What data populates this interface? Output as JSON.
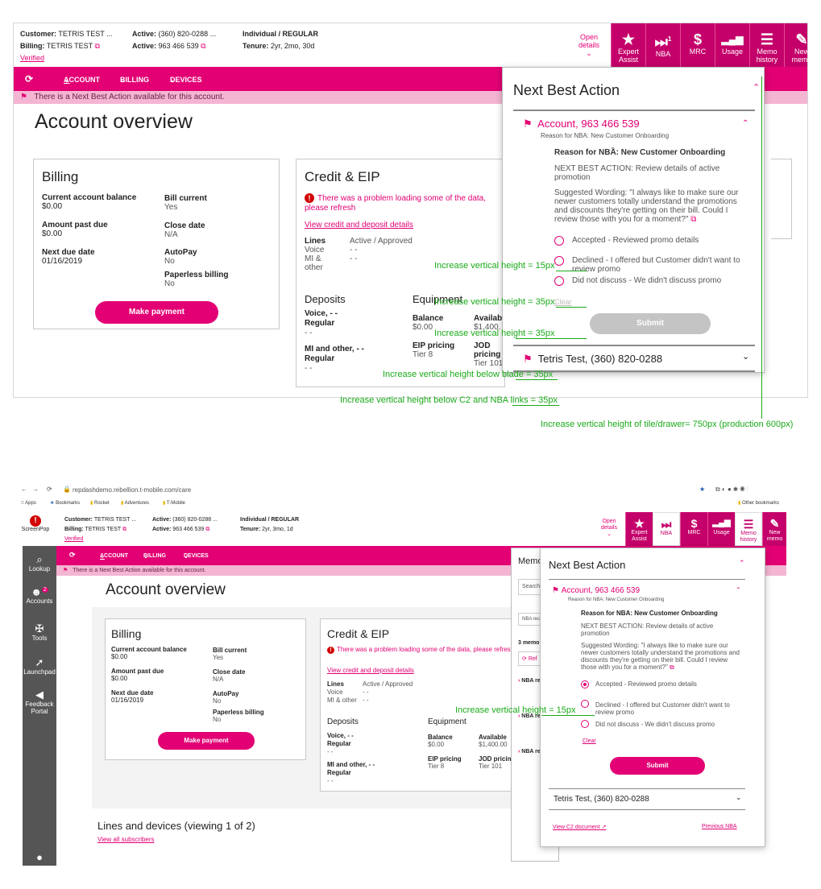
{
  "top": {
    "customer_label": "Customer:",
    "customer_value": "TETRIS TEST",
    "billing_label": "Billing:",
    "billing_value": "TETRIS TEST",
    "verified": "Verified",
    "active_label": "Active:",
    "active_phone": "(360) 820-0288",
    "active_account": "963 466 539",
    "type": "Individual  /  REGULAR",
    "tenure_label": "Tenure:",
    "tenure_value": "2yr, 2mo, 30d",
    "open_details": "Open details",
    "buttons": [
      {
        "label": "Expert Assist",
        "icon": "star-icon",
        "glyph": "★"
      },
      {
        "label": "NBA",
        "icon": "nba-icon",
        "glyph": "⏭",
        "badge": "1"
      },
      {
        "label": "MRC",
        "icon": "dollar-icon",
        "glyph": "$"
      },
      {
        "label": "Usage",
        "icon": "signal-bars-icon",
        "glyph": "▂▄▆"
      },
      {
        "label": "Memo history",
        "icon": "list-icon",
        "glyph": "☰"
      },
      {
        "label": "New memo",
        "icon": "edit-icon",
        "glyph": "✎"
      }
    ],
    "nav": {
      "account": "ACCOUNT",
      "billing": "BILLING",
      "devices": "DEVICES"
    },
    "nba_banner": "There is a Next Best Action available for this account.",
    "page_title": "Account overview",
    "billing": {
      "title": "Billing",
      "current_balance_label": "Current account balance",
      "current_balance": "$0.00",
      "past_due_label": "Amount past due",
      "past_due": "$0.00",
      "next_due_label": "Next due date",
      "next_due": "01/16/2019",
      "bill_current_label": "Bill current",
      "bill_current": "Yes",
      "close_date_label": "Close date",
      "close_date": "N/A",
      "autopay_label": "AutoPay",
      "autopay": "No",
      "paperless_label": "Paperless billing",
      "paperless": "No",
      "pay_button": "Make payment"
    },
    "credit": {
      "title": "Credit & EIP",
      "error": "There was a problem loading some of the data, please refresh",
      "link": "View credit and deposit details",
      "lines_label": "Lines",
      "status": "Active / Approved",
      "voice": "Voice",
      "voice_val": "- -",
      "mi": "MI & other",
      "mi_val": "- -",
      "deposits": "Deposits",
      "dep_voice": "Voice, - -",
      "dep_regular": "Regular",
      "dep_dash": "- -",
      "dep_mi": "MI and other, - -",
      "dep_regular2": "Regular",
      "dep_dash2": "- -",
      "equipment": "Equipment",
      "balance_label": "Balance",
      "balance": "$0.00",
      "available_label": "Available",
      "available": "$1,400.",
      "eip_label": "EIP pricing",
      "eip": "Tier 8",
      "jod_label": "JOD pricing",
      "jod": "Tier 101"
    },
    "nba": {
      "title": "Next Best Action",
      "account_head": "Account, 963 466 539",
      "reason_sub": "Reason for NBA: New Customer Onboarding",
      "reason_bold": "Reason for NBẦ: New Customer Onboarding",
      "action": "NEXT BEST ACTION: Review details of active promotion",
      "wording": "Suggested Wording: \"I always like to make sure our newer customers totally understand the promotions and discounts they're getting on their bill. Could I review those with you for a moment?\"",
      "opt1": "Accepted - Reviewed promo details",
      "opt2": "Declined - I offered but Customer didn't want to review promo",
      "opt3": "Did not discuss - We didn't discuss promo",
      "clear": "Clear",
      "submit": "Submit",
      "second": "Tetris Test, (360) 820-0288"
    },
    "annotations": [
      "Increase vertical height = 15px",
      "Increase vertical height = 35px",
      "Increase vertical height = 35px",
      "Increase vertical height below blade = 35px",
      "Increase vertical height below C2 and NBA links = 35px",
      "Increase vertical height of tile/drawer= 750px (production 600px)"
    ]
  },
  "bottom": {
    "url": "repdashdemo.rebellion.t-mobile.com/care",
    "bookmarks": [
      "Apps",
      "Bookmarks",
      "Rocket",
      "Adventures",
      "T-Mobile"
    ],
    "other_bookmarks": "Other bookmarks",
    "screenpop": "ScreenPop",
    "customer_value": "TETRIS TEST",
    "billing_value": "TETRIS TEST",
    "verified": "Verified",
    "active_phone": "(360) 820-0288",
    "active_account": "963 466 539",
    "type": "Individual  /  REGULAR",
    "tenure_value": "2yr, 3mo, 1d",
    "open_details": "Open details",
    "sidebar": [
      {
        "label": "Lookup",
        "icon": "search-icon",
        "glyph": "🔍"
      },
      {
        "label": "Accounts",
        "icon": "people-icon",
        "glyph": "👥",
        "badge": "2"
      },
      {
        "label": "Tools",
        "icon": "wrench-icon",
        "glyph": "🔧"
      },
      {
        "label": "Launchpad",
        "icon": "rocket-icon",
        "glyph": "🚀"
      },
      {
        "label": "Feedback Portal",
        "icon": "megaphone-icon",
        "glyph": "📢"
      }
    ],
    "page_title": "Account overview",
    "pay_button": "Make payment",
    "credit_error": "There was a problem loading some of the data, please refresh",
    "credit_link": "View credit and deposit details",
    "available": "$1,400.00",
    "jod": "JOD pricing",
    "tier101": "Tier 101",
    "lines_title": "Lines and devices (viewing 1 of 2)",
    "view_all": "View all subscribers",
    "memo": {
      "title": "Memo",
      "search": "Search",
      "nba_rec": "NBA rec",
      "count": "3 memo",
      "ref": "Ref",
      "item": "NBA recomm"
    },
    "nba": {
      "title": "Next Best Action",
      "account_head": "Account, 963 466 539",
      "reason_sub": "Reason for NBA: New Customer Onboarding",
      "reason_bold": "Reason for NBA: New Customer Onboarding",
      "action": "NEXT BEST ACTION: Review details of active promotion",
      "wording": "Suggested Wording: \"I always like to make sure our newer customers totally understand the promotions and discounts they're getting on their bill. Could I review those with you for a moment?\"",
      "opt1": "Accepted - Reviewed promo details",
      "opt2": "Declined - I offered but Customer didn't want to review promo",
      "opt3": "Did not discuss - We didn't discuss promo",
      "clear": "Clear",
      "submit": "Submit",
      "second": "Tetris Test, (360) 820-0288",
      "c2_link": "View C2 document",
      "prev_link": "Previous NBA"
    },
    "annotation": "Increase vertical height = 15px"
  }
}
